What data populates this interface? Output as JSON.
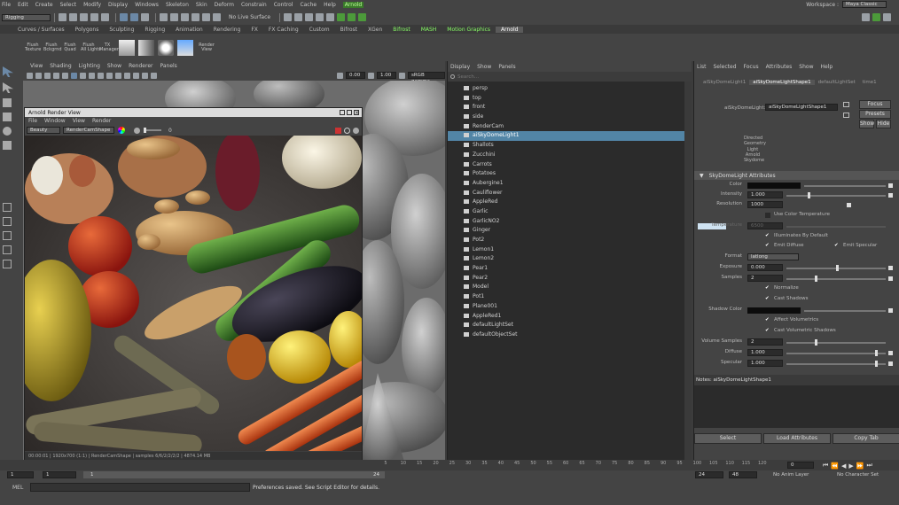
{
  "menubar": {
    "items": [
      "File",
      "Edit",
      "Create",
      "Select",
      "Modify",
      "Display",
      "Windows",
      "Skeleton",
      "Skin",
      "Deform",
      "Constrain",
      "Control",
      "Cache",
      "Help",
      "Arnold"
    ],
    "workspace_label": "Workspace :",
    "workspace_value": "Maya Classic"
  },
  "statusline": {
    "mode": "Rigging",
    "no_live": "No Live Surface"
  },
  "shelf": {
    "tabs": [
      "Curves / Surfaces",
      "Polygons",
      "Sculpting",
      "Rigging",
      "Animation",
      "Rendering",
      "FX",
      "FX Caching",
      "Custom",
      "Bifrost",
      "XGen",
      "Bifrost",
      "MASH",
      "Motion Graphics",
      "Arnold"
    ],
    "active": "Arnold",
    "icons": [
      {
        "label": "Flush\nTexture",
        "icon": "flush-texture-icon"
      },
      {
        "label": "Flush\nBckgrnd",
        "icon": "flush-background-icon"
      },
      {
        "label": "Flush\nQuad",
        "icon": "flush-quad-icon"
      },
      {
        "label": "Flush\nAll Lights",
        "icon": "flush-lights-icon"
      },
      {
        "label": "TX\nManager",
        "icon": "tx-manager-icon"
      },
      {
        "label": "Render\nView",
        "icon": "render-view-icon"
      }
    ]
  },
  "viewport": {
    "menu": [
      "View",
      "Shading",
      "Lighting",
      "Show",
      "Renderer",
      "Panels"
    ],
    "exposure": "0.00",
    "gamma": "1.00",
    "colorspace": "sRGB gamma"
  },
  "renderview": {
    "title": "Arnold Render View",
    "menu": [
      "File",
      "Window",
      "View",
      "Render"
    ],
    "aov": "Beauty",
    "camera": "RenderCamShape",
    "exposure": "0",
    "status": "00:00:01 | 1920x700 (1:1) | RenderCamShape | samples 6/6/2/2/2/2 | 4874.14 MB"
  },
  "outliner": {
    "menu": [
      "Display",
      "Show",
      "Panels"
    ],
    "search_placeholder": "Search...",
    "items": [
      {
        "label": "persp",
        "sel": false
      },
      {
        "label": "top",
        "sel": false
      },
      {
        "label": "front",
        "sel": false
      },
      {
        "label": "side",
        "sel": false
      },
      {
        "label": "RenderCam",
        "sel": false
      },
      {
        "label": "aiSkyDomeLight1",
        "sel": true
      },
      {
        "label": "Shallots",
        "sel": false
      },
      {
        "label": "Zucchini",
        "sel": false
      },
      {
        "label": "Carrots",
        "sel": false
      },
      {
        "label": "Potatoes",
        "sel": false
      },
      {
        "label": "Aubergine1",
        "sel": false
      },
      {
        "label": "Cauliflower",
        "sel": false
      },
      {
        "label": "AppleRed",
        "sel": false
      },
      {
        "label": "Garlic",
        "sel": false
      },
      {
        "label": "GarlicNO2",
        "sel": false
      },
      {
        "label": "Ginger",
        "sel": false
      },
      {
        "label": "Pot2",
        "sel": false
      },
      {
        "label": "Lemon1",
        "sel": false
      },
      {
        "label": "Lemon2",
        "sel": false
      },
      {
        "label": "Pear1",
        "sel": false
      },
      {
        "label": "Pear2",
        "sel": false
      },
      {
        "label": "Model",
        "sel": false
      },
      {
        "label": "Pot1",
        "sel": false
      },
      {
        "label": "Plane001",
        "sel": false
      },
      {
        "label": "AppleRed1",
        "sel": false
      },
      {
        "label": "defaultLightSet",
        "sel": false
      },
      {
        "label": "defaultObjectSet",
        "sel": false
      }
    ]
  },
  "attr": {
    "menu": [
      "List",
      "Selected",
      "Focus",
      "Attributes",
      "Show",
      "Help"
    ],
    "tabs": [
      "aiSkyDomeLight1",
      "aiSkyDomeLightShape1",
      "defaultLightSet",
      "time1"
    ],
    "node_label": "aiSkyDomeLight:",
    "node_value": "aiSkyDomeLightShape1",
    "focus": "Focus",
    "presets": "Presets",
    "show": "Show",
    "hide": "Hide",
    "types": [
      "Directed",
      "Geometry",
      "Light",
      "Arnold",
      "Skydome"
    ],
    "section": "SkyDomeLight Attributes",
    "fields": {
      "color": "Color",
      "intensity_label": "Intensity",
      "intensity": "1.000",
      "resolution_label": "Resolution",
      "resolution": "1000",
      "use_color_temp": "Use Color Temperature",
      "temperature_label": "Temperature",
      "temperature": "6500",
      "illuminates": "Illuminates By Default",
      "emit_diffuse": "Emit Diffuse",
      "emit_specular": "Emit Specular",
      "format_label": "Format",
      "format": "latlong",
      "exposure_label": "Exposure",
      "exposure": "0.000",
      "samples_label": "Samples",
      "samples": "2",
      "normalize": "Normalize",
      "cast_shadows": "Cast Shadows",
      "shadow_color": "Shadow Color",
      "affect_vol": "Affect Volumetrics",
      "cast_vol": "Cast Volumetric Shadows",
      "vol_samples_label": "Volume Samples",
      "vol_samples": "2",
      "diffuse_label": "Diffuse",
      "diffuse": "1.000",
      "specular_label": "Specular",
      "specular": "1.000"
    },
    "notes": "Notes: aiSkyDomeLightShape1",
    "select": "Select",
    "load": "Load Attributes",
    "copy": "Copy Tab"
  },
  "timeline": {
    "ticks": [
      "5",
      "10",
      "15",
      "20",
      "25",
      "30",
      "35",
      "40",
      "45",
      "50",
      "55",
      "60",
      "65",
      "70",
      "75",
      "80",
      "85",
      "90",
      "95",
      "100",
      "105",
      "110",
      "115",
      "120"
    ],
    "current": "0"
  },
  "range": {
    "start": "1",
    "inner_start": "1",
    "slider_label": "1",
    "inner_end": "24",
    "end": "24",
    "end2": "48",
    "anim_layer": "No Anim Layer",
    "char_set": "No Character Set"
  },
  "helpline": {
    "mel": "MEL",
    "message": "Preferences saved. See Script Editor for details."
  },
  "colors": {
    "accent": "#5285a6",
    "arnold": "#88ff66"
  }
}
